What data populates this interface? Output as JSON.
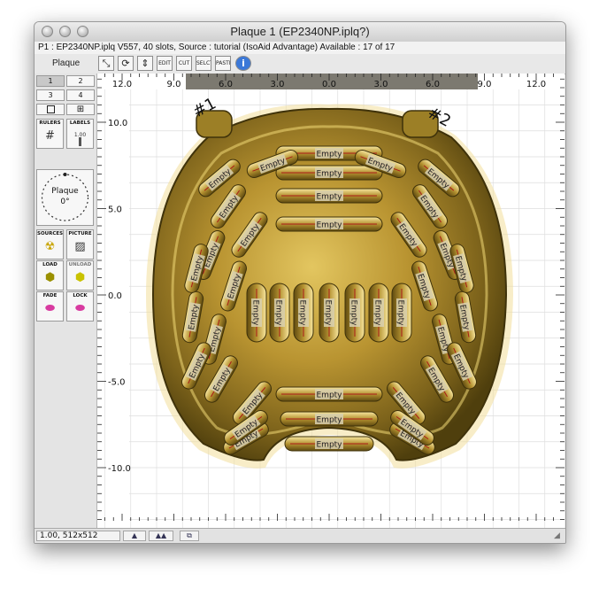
{
  "window": {
    "title": "Plaque 1 (EP2340NP.iplq?)",
    "info": "P1 : EP2340NP.iplq V557, 40 slots, Source : tutorial (IsoAid Advantage) Available : 17 of 17"
  },
  "toolbar": {
    "plaque_label": "Plaque",
    "buttons": [
      {
        "name": "cursor-tool-icon",
        "label": "⤡",
        "icon": true
      },
      {
        "name": "rotate-tool-icon",
        "label": "⟳",
        "icon": true
      },
      {
        "name": "move-tool-icon",
        "label": "⇕",
        "icon": true
      },
      {
        "name": "edit-button",
        "label": "EDIT",
        "icon": false
      },
      {
        "name": "cut-button",
        "label": "CUT",
        "icon": false
      },
      {
        "name": "select-button",
        "label": "SELCT",
        "icon": false
      },
      {
        "name": "paste-button",
        "label": "PASTE",
        "icon": false
      }
    ],
    "info_icon": "i"
  },
  "sidebar": {
    "plaque_numbers": [
      "1",
      "2",
      "3",
      "4"
    ],
    "selected_plaque": "1",
    "view_icons": [
      "single-view-icon",
      "grid-view-icon"
    ],
    "tools": {
      "rulers": "RULERS",
      "labels": "LABELS",
      "labels_value": "1.00",
      "dial_label": "Plaque",
      "dial_angle": "0°",
      "sources": "SOURCES",
      "picture": "PICTURE",
      "load": "LOAD",
      "unload": "UNLOAD",
      "fade": "FADE",
      "lock": "LOCK"
    }
  },
  "canvas": {
    "h_ticks": [
      "12.0",
      "9.0",
      "6.0",
      "3.0",
      "0.0",
      "3.0",
      "6.0",
      "9.0",
      "12.0"
    ],
    "v_ticks": [
      "10.0",
      "5.0",
      "0.0",
      "-5.0",
      "-10.0"
    ],
    "markers": [
      "#1",
      "#2"
    ],
    "slot_label": "Empty",
    "slot_count": 40
  },
  "status": {
    "zoom": "1.00, 512x512"
  },
  "colors": {
    "gold_light": "#f2d877",
    "gold_mid": "#c9a83a",
    "gold_dark": "#6e5710",
    "grid": "#d6d6d6",
    "marker_line": "#aa1a1a"
  }
}
